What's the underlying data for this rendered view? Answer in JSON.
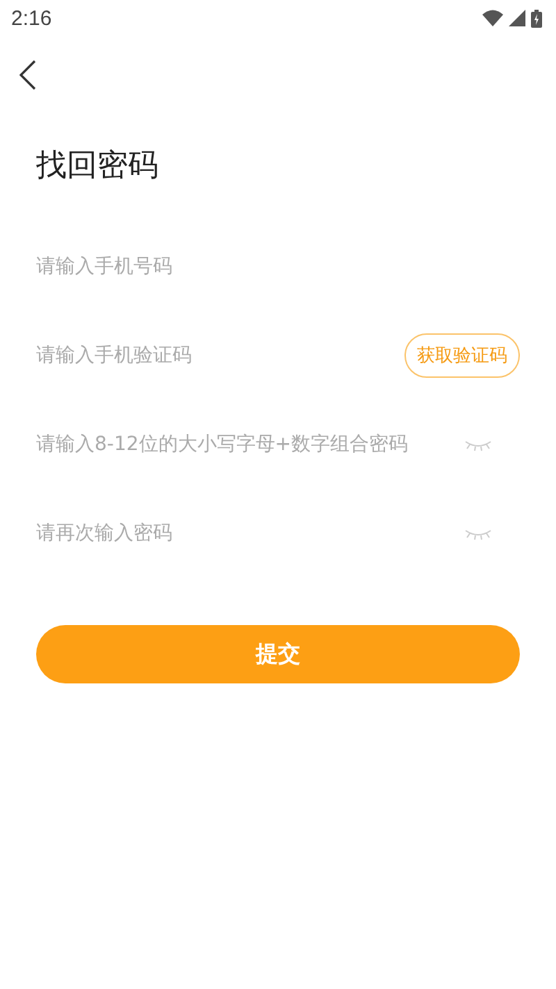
{
  "status_bar": {
    "time": "2:16"
  },
  "title": "找回密码",
  "fields": [
    {
      "kind": "text",
      "placeholder": "请输入手机号码"
    },
    {
      "kind": "code",
      "placeholder": "请输入手机验证码",
      "action": "获取验证码"
    },
    {
      "kind": "password",
      "placeholder": "请输入8-12位的大小写字母+数字组合密码"
    },
    {
      "kind": "password",
      "placeholder": "请再次输入密码"
    }
  ],
  "submit": "提交"
}
